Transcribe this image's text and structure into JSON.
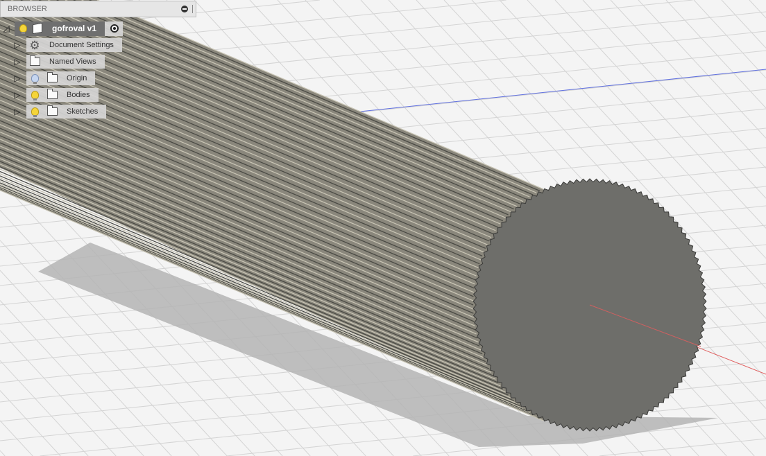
{
  "browser": {
    "title": "BROWSER",
    "root": {
      "label": "gofroval v1"
    },
    "items": [
      {
        "label": "Document Settings",
        "icon": "gear-icon"
      },
      {
        "label": "Named Views",
        "icon": "folder-icon"
      },
      {
        "label": "Origin",
        "icon": "folder-icon",
        "visibility": "off"
      },
      {
        "label": "Bodies",
        "icon": "folder-icon",
        "visibility": "on"
      },
      {
        "label": "Sketches",
        "icon": "folder-icon",
        "visibility": "on"
      }
    ]
  },
  "colors": {
    "body": "#8a877c",
    "end_face": "#6e6e6a",
    "grid": "#d4d4d4",
    "x_axis": "#e05050",
    "y_axis": "#5060e0"
  }
}
